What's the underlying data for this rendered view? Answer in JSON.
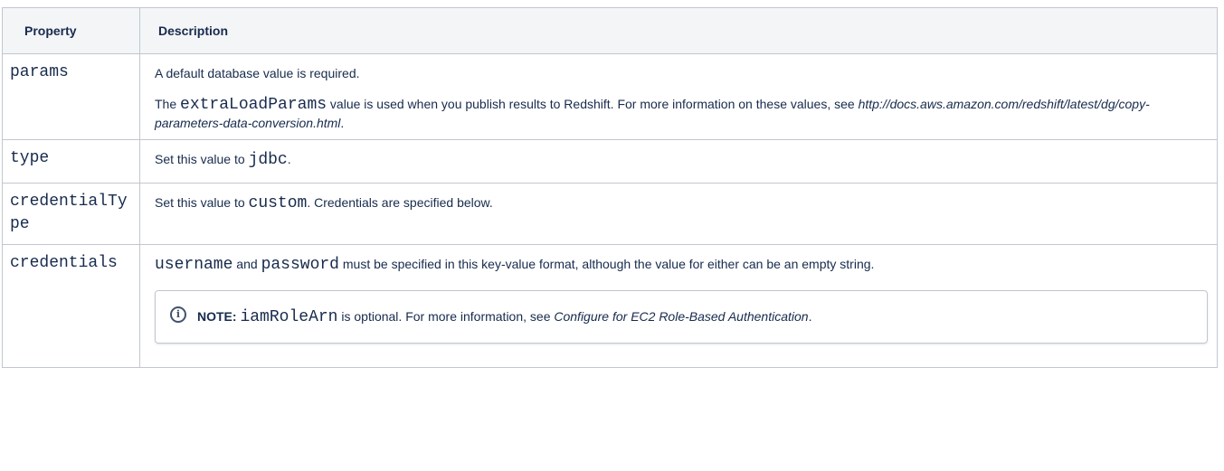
{
  "table": {
    "headers": {
      "property": "Property",
      "description": "Description"
    },
    "rows": {
      "params": {
        "property": "params",
        "line1": "A default database value is required.",
        "line2_pre": "The ",
        "line2_code": "extraLoadParams",
        "line2_post": " value is used when you publish results to Redshift. For more information on these values, see ",
        "line2_link": "http://docs.aws.amazon.com/redshift/latest/dg/copy-parameters-data-conversion.html",
        "line2_end": "."
      },
      "type": {
        "property": "type",
        "pre": "Set this value to ",
        "code": "jdbc",
        "post": "."
      },
      "credentialType": {
        "property": "credentialType",
        "pre": "Set this value to ",
        "code": "custom",
        "post": ". Credentials are specified below."
      },
      "credentials": {
        "property": "credentials",
        "code1": "username",
        "mid": " and ",
        "code2": "password",
        "post": " must be specified in this key-value format, although the value for either can be an empty string.",
        "note": {
          "icon": "info-icon",
          "label": "NOTE:",
          "code": "iamRoleArn",
          "text": " is optional. For more information, see ",
          "link": "Configure for EC2 Role-Based Authentication",
          "end": "."
        }
      }
    }
  }
}
